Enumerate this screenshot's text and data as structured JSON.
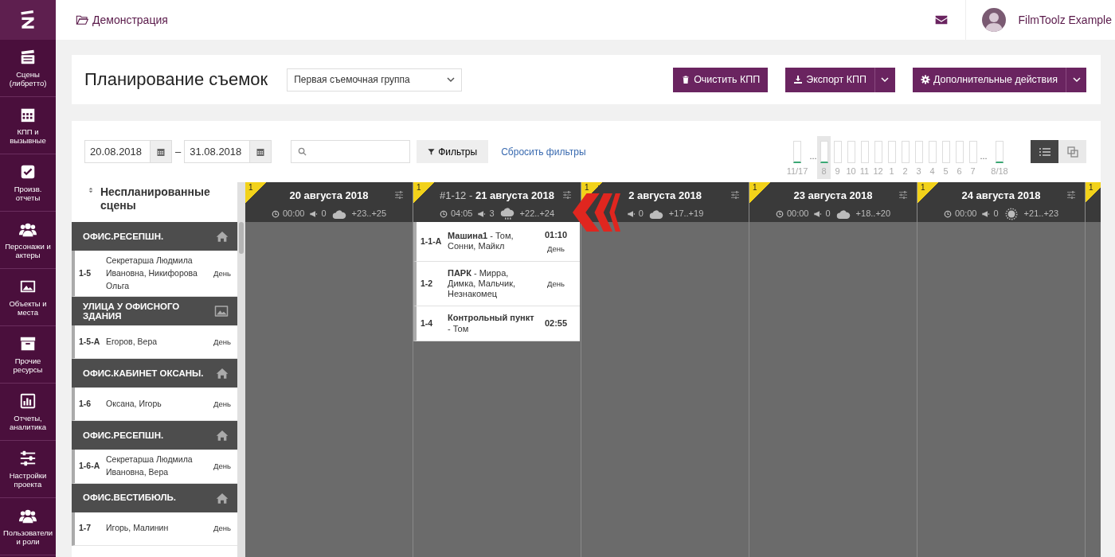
{
  "sidebar": {
    "items": [
      {
        "label": "Сцены (либретто)"
      },
      {
        "label": "КПП и вызывные"
      },
      {
        "label": "Произв. отчеты"
      },
      {
        "label": "Персонажи и актеры"
      },
      {
        "label": "Объекты и места"
      },
      {
        "label": "Прочие ресурсы"
      },
      {
        "label": "Отчеты, аналитика"
      },
      {
        "label": "Настройки проекта"
      },
      {
        "label": "Пользователи и роли"
      }
    ]
  },
  "topbar": {
    "breadcrumb": "Демонстрация",
    "user": "FilmToolz Example"
  },
  "header": {
    "title": "Планирование съемок",
    "group_select": "Первая съемочная группа",
    "buttons": [
      {
        "label": "Очистить КПП",
        "dropdown": false
      },
      {
        "label": "Экспорт КПП",
        "dropdown": true
      },
      {
        "label": "Дополнительные действия",
        "dropdown": true
      }
    ]
  },
  "filters": {
    "date_from": "20.08.2018",
    "date_sep": "–",
    "date_to": "31.08.2018",
    "filters_button": "Фильтры",
    "reset_link": "Сбросить фильтры"
  },
  "timeline": [
    {
      "kind": "bar",
      "label": "11/17",
      "marked": true,
      "selected": false
    },
    {
      "kind": "gap",
      "label": "..."
    },
    {
      "kind": "bar",
      "label": "8",
      "marked": true,
      "selected": true
    },
    {
      "kind": "bar",
      "label": "9",
      "marked": false,
      "selected": false
    },
    {
      "kind": "bar",
      "label": "10",
      "marked": false,
      "selected": false
    },
    {
      "kind": "bar",
      "label": "11",
      "marked": false,
      "selected": false
    },
    {
      "kind": "bar",
      "label": "12",
      "marked": false,
      "selected": false
    },
    {
      "kind": "bar",
      "label": "1",
      "marked": false,
      "selected": false
    },
    {
      "kind": "bar",
      "label": "2",
      "marked": false,
      "selected": false
    },
    {
      "kind": "bar",
      "label": "3",
      "marked": false,
      "selected": false
    },
    {
      "kind": "bar",
      "label": "4",
      "marked": false,
      "selected": false
    },
    {
      "kind": "bar",
      "label": "5",
      "marked": false,
      "selected": false
    },
    {
      "kind": "bar",
      "label": "6",
      "marked": false,
      "selected": false
    },
    {
      "kind": "bar",
      "label": "7",
      "marked": false,
      "selected": false
    },
    {
      "kind": "gap",
      "label": "..."
    },
    {
      "kind": "bar",
      "label": "8/18",
      "marked": true,
      "selected": false
    }
  ],
  "view_toggle": [
    {
      "selected": true
    },
    {
      "selected": false
    }
  ],
  "unplanned": {
    "title": "Неспланированные сцены",
    "groups": [
      {
        "name": "ОФИС.РЕСЕПШН.",
        "kind": "interior",
        "scenes": [
          {
            "id": "1-5",
            "text": "Секретарша Людмила Ивановна, Никифорова Ольга",
            "daypart": "День"
          }
        ]
      },
      {
        "name": "УЛИЦА У ОФИСНОГО ЗДАНИЯ",
        "kind": "exterior",
        "scenes": [
          {
            "id": "1-5-А",
            "text": "Егоров, Вера",
            "daypart": "День"
          }
        ]
      },
      {
        "name": "ОФИС.КАБИНЕТ ОКСАНЫ.",
        "kind": "interior",
        "scenes": [
          {
            "id": "1-6",
            "text": "Оксана, Игорь",
            "daypart": "День"
          }
        ]
      },
      {
        "name": "ОФИС.РЕСЕПШН.",
        "kind": "interior",
        "scenes": [
          {
            "id": "1-6-А",
            "text": "Секретарша Людмила Ивановна, Вера",
            "daypart": "День"
          }
        ]
      },
      {
        "name": "ОФИС.ВЕСТИБЮЛЬ.",
        "kind": "interior",
        "scenes": [
          {
            "id": "1-7",
            "text": "Игорь, Малинин",
            "daypart": "День"
          }
        ]
      }
    ]
  },
  "days": [
    {
      "corner": "1",
      "title": "20 августа 2018",
      "time": "00:00",
      "calls": "0",
      "kind": "cloudy",
      "temp": "+23..+25"
    },
    {
      "corner": "1",
      "prefix": "#1-12 - ",
      "title": "21 августа 2018",
      "time": "04:05",
      "calls": "3",
      "kind": "rainy",
      "temp": "+22..+24",
      "scenes": [
        {
          "id": "1-1-А",
          "text": "**Машина1** - Том, Сонни, Майкл",
          "time": "01:10",
          "daypart": "День"
        },
        {
          "id": "1-2",
          "text": "**ПАРК** - Мирра, Димка, Мальчик, Незнакомец",
          "daypart": "День"
        },
        {
          "id": "1-4",
          "text": "**Контрольный пункт** - Том",
          "time": "02:55"
        }
      ]
    },
    {
      "corner": "1",
      "title": "2 августа 2018",
      "calls": "0",
      "kind": "cloudy",
      "temp": "+17..+19"
    },
    {
      "corner": "1",
      "title": "23 августа 2018",
      "time": "00:00",
      "calls": "0",
      "kind": "cloudy",
      "temp": "+18..+20"
    },
    {
      "corner": "1",
      "title": "24 августа 2018",
      "time": "00:00",
      "calls": "0",
      "kind": "sunny",
      "temp": "+21..+23"
    },
    {
      "corner": "1"
    }
  ]
}
